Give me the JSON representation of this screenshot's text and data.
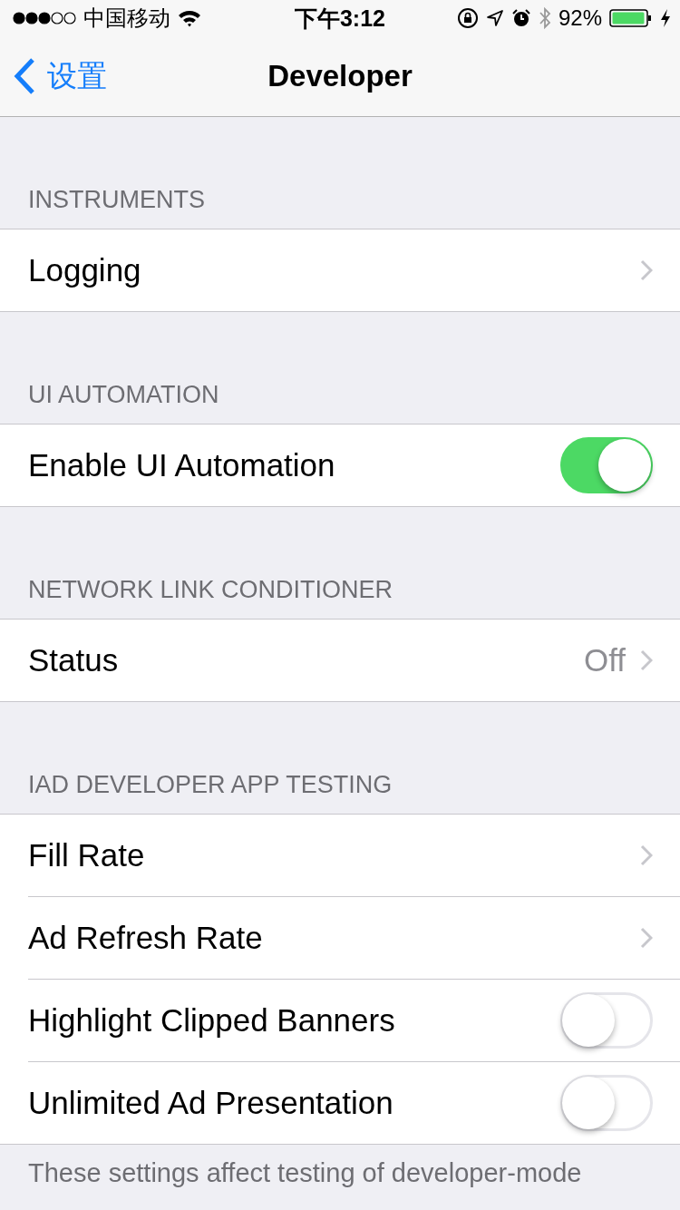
{
  "status_bar": {
    "carrier": "中国移动",
    "time": "下午3:12",
    "battery": "92%"
  },
  "nav": {
    "back": "设置",
    "title": "Developer"
  },
  "sections": [
    {
      "header": "INSTRUMENTS",
      "rows": [
        {
          "kind": "link",
          "label": "Logging"
        }
      ]
    },
    {
      "header": "UI AUTOMATION",
      "rows": [
        {
          "kind": "toggle",
          "label": "Enable UI Automation",
          "on": true
        }
      ]
    },
    {
      "header": "NETWORK LINK CONDITIONER",
      "rows": [
        {
          "kind": "link",
          "label": "Status",
          "value": "Off"
        }
      ]
    },
    {
      "header": "IAD DEVELOPER APP TESTING",
      "rows": [
        {
          "kind": "link",
          "label": "Fill Rate"
        },
        {
          "kind": "link",
          "label": "Ad Refresh Rate"
        },
        {
          "kind": "toggle",
          "label": "Highlight Clipped Banners",
          "on": false
        },
        {
          "kind": "toggle",
          "label": "Unlimited Ad Presentation",
          "on": false
        }
      ],
      "footer": "These settings affect testing of developer-mode"
    }
  ]
}
